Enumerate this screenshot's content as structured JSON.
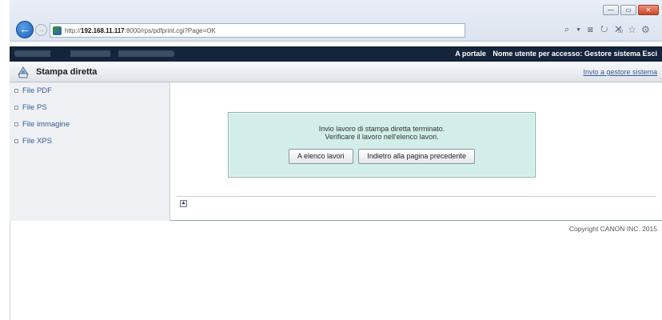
{
  "browser": {
    "url_prefix": "http://",
    "url_host": "192.168.11.117",
    "url_rest": ":8000/rps/pdfprint.cgi?Page=OK",
    "search_tools": "⌕ ▾ ⊠ ↻ ✕",
    "win_minimize": "—",
    "win_maximize": "▭",
    "win_close": "✕"
  },
  "topbar": {
    "portal_link": "A portale",
    "user_label": "Nome utente per accesso: Gestore sistema",
    "logout_link": "Esci"
  },
  "titlebar": {
    "title": "Stampa diretta",
    "admin_link": "Invio a gestore sistema"
  },
  "sidebar": {
    "items": [
      {
        "label": "File PDF"
      },
      {
        "label": "File PS"
      },
      {
        "label": "File immagine"
      },
      {
        "label": "File XPS"
      }
    ]
  },
  "message": {
    "line1": "Invio lavoro di stampa diretta terminato.",
    "line2": "Verificare il lavoro nell'elenco lavori.",
    "button_jobs": "A elenco lavori",
    "button_back": "Indietro alla pagina precedente"
  },
  "footer": {
    "copyright": "Copyright CANON INC. 2015"
  },
  "icons": {
    "back": "arrow-left-icon",
    "forward": "arrow-right-icon",
    "home": "home-icon",
    "favorites": "star-icon",
    "settings": "gear-icon",
    "page_top": "page-top-icon"
  },
  "colors": {
    "topbar_bg": "#14243b",
    "message_bg": "#d3eeea",
    "link": "#3a5b92"
  }
}
